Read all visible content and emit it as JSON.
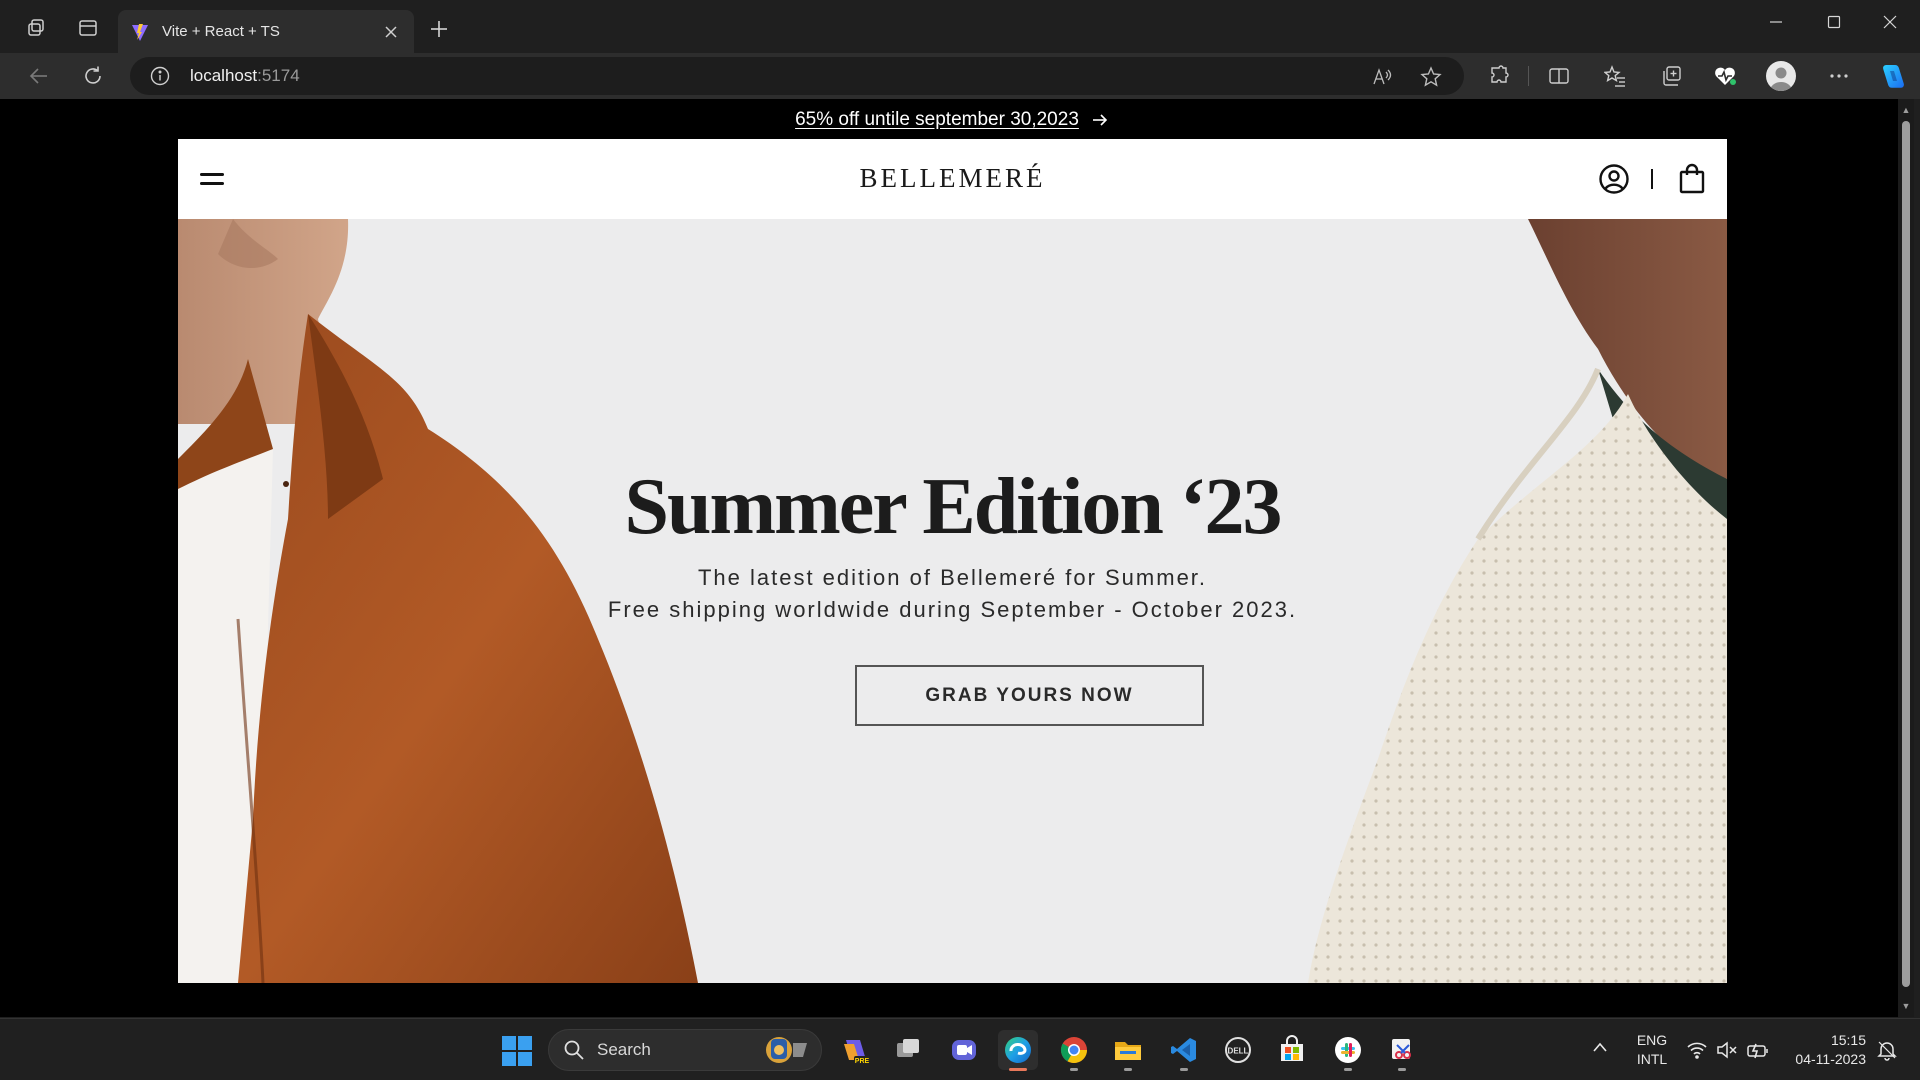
{
  "browser": {
    "tab_title": "Vite + React + TS",
    "address_host": "localhost",
    "address_port": ":5174"
  },
  "site": {
    "promo_text": "65% off untile september 30,2023",
    "logo": "BELLEMERÉ",
    "hero": {
      "title": "Summer Edition ‘23",
      "subtitle_line1": "The latest edition of Bellemeré for Summer.",
      "subtitle_line2": "Free shipping worldwide during September - October 2023.",
      "cta_label": "GRAB YOURS NOW"
    },
    "colors": {
      "hero_bg": "#ececed",
      "header_bg": "#ffffff",
      "text_dark": "#1c1c1c"
    }
  },
  "taskbar": {
    "search_label": "Search",
    "lang_line1": "ENG",
    "lang_line2": "INTL",
    "time": "15:15",
    "date": "04-11-2023"
  }
}
